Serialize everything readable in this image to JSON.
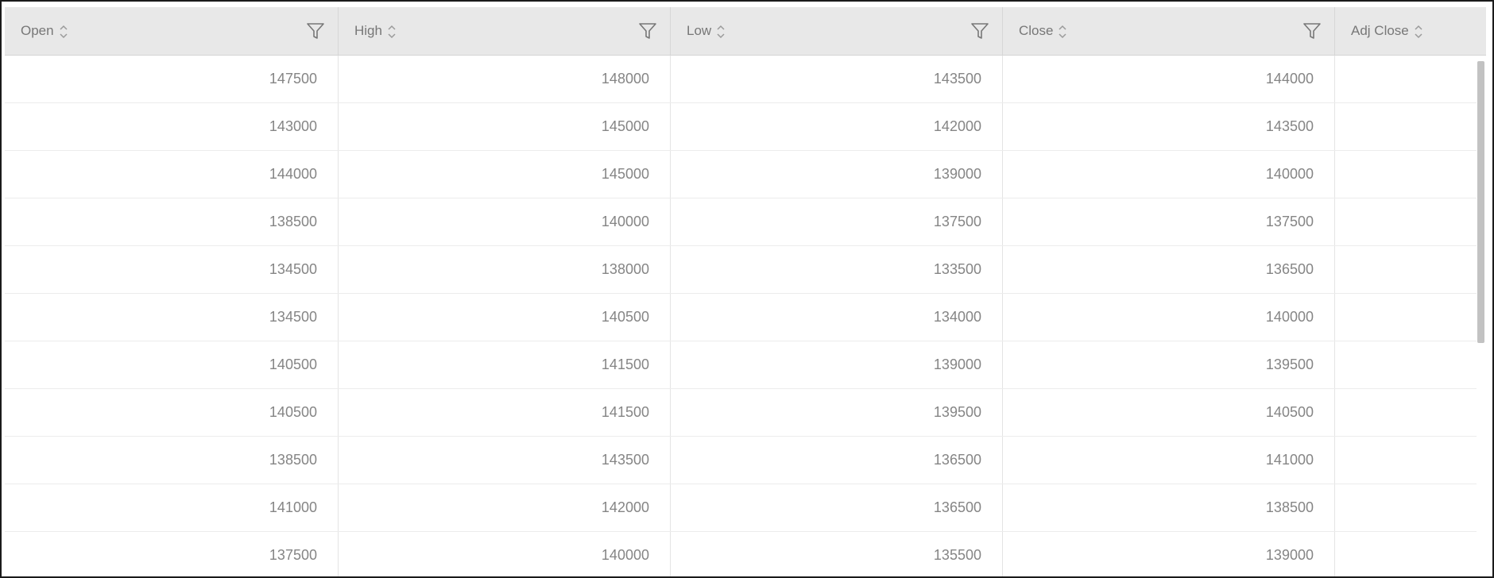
{
  "table": {
    "columns": [
      {
        "label": "Open"
      },
      {
        "label": "High"
      },
      {
        "label": "Low"
      },
      {
        "label": "Close"
      },
      {
        "label": "Adj Close"
      }
    ],
    "rows": [
      {
        "open": "147500",
        "high": "148000",
        "low": "143500",
        "close": "144000",
        "adj_close": ""
      },
      {
        "open": "143000",
        "high": "145000",
        "low": "142000",
        "close": "143500",
        "adj_close": ""
      },
      {
        "open": "144000",
        "high": "145000",
        "low": "139000",
        "close": "140000",
        "adj_close": ""
      },
      {
        "open": "138500",
        "high": "140000",
        "low": "137500",
        "close": "137500",
        "adj_close": ""
      },
      {
        "open": "134500",
        "high": "138000",
        "low": "133500",
        "close": "136500",
        "adj_close": ""
      },
      {
        "open": "134500",
        "high": "140500",
        "low": "134000",
        "close": "140000",
        "adj_close": ""
      },
      {
        "open": "140500",
        "high": "141500",
        "low": "139000",
        "close": "139500",
        "adj_close": ""
      },
      {
        "open": "140500",
        "high": "141500",
        "low": "139500",
        "close": "140500",
        "adj_close": ""
      },
      {
        "open": "138500",
        "high": "143500",
        "low": "136500",
        "close": "141000",
        "adj_close": ""
      },
      {
        "open": "141000",
        "high": "142000",
        "low": "136500",
        "close": "138500",
        "adj_close": ""
      },
      {
        "open": "137500",
        "high": "140000",
        "low": "135500",
        "close": "139000",
        "adj_close": ""
      }
    ]
  },
  "icons": {
    "sort": "sort-icon",
    "filter": "filter-icon"
  },
  "colors": {
    "header_bg": "#e8e8e8",
    "text": "#858585",
    "border": "#e4e4e4"
  }
}
